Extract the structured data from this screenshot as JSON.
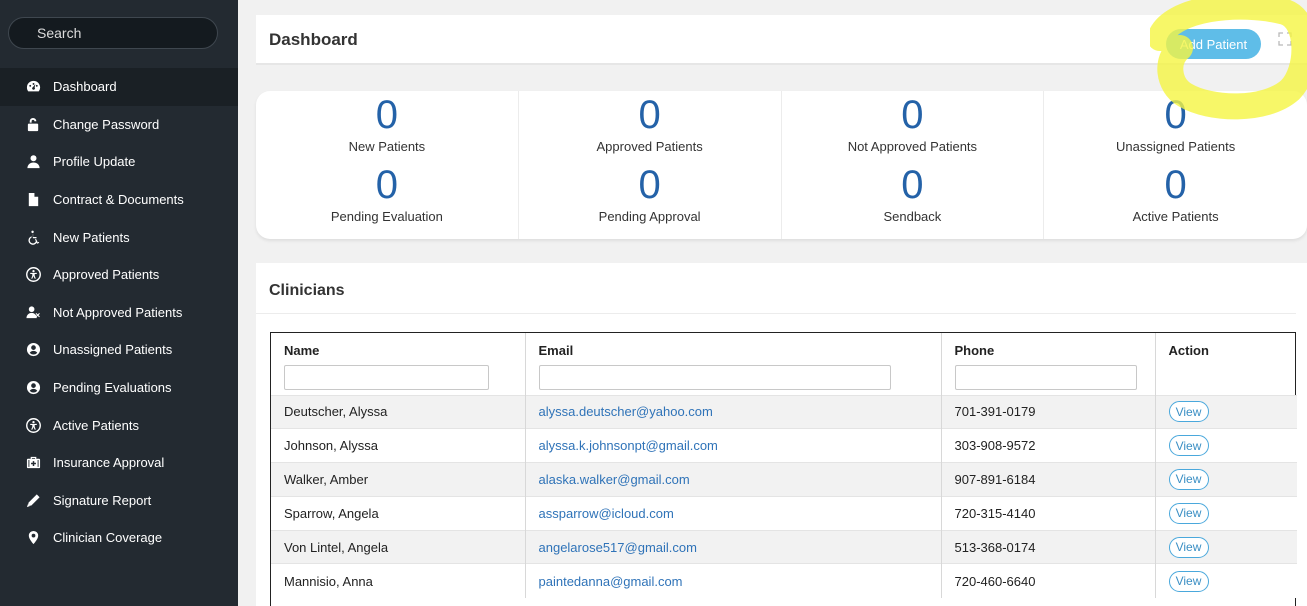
{
  "sidebar": {
    "search_placeholder": "Search",
    "items": [
      {
        "label": "Dashboard",
        "icon": "tachometer-icon"
      },
      {
        "label": "Change Password",
        "icon": "unlock-icon"
      },
      {
        "label": "Profile Update",
        "icon": "user-icon"
      },
      {
        "label": "Contract & Documents",
        "icon": "file-icon"
      },
      {
        "label": "New Patients",
        "icon": "wheelchair-icon"
      },
      {
        "label": "Approved Patients",
        "icon": "accessibility-icon"
      },
      {
        "label": "Not Approved Patients",
        "icon": "user-times-icon"
      },
      {
        "label": "Unassigned Patients",
        "icon": "user-circle-icon"
      },
      {
        "label": "Pending Evaluations",
        "icon": "user-circle-icon"
      },
      {
        "label": "Active Patients",
        "icon": "accessibility-icon"
      },
      {
        "label": "Insurance Approval",
        "icon": "medkit-icon"
      },
      {
        "label": "Signature Report",
        "icon": "pencil-icon"
      },
      {
        "label": "Clinician Coverage",
        "icon": "map-marker-icon"
      }
    ]
  },
  "header": {
    "title": "Dashboard",
    "add_patient_label": "Add Patient"
  },
  "stats": [
    {
      "value": "0",
      "label": "New Patients"
    },
    {
      "value": "0",
      "label": "Approved Patients"
    },
    {
      "value": "0",
      "label": "Not Approved Patients"
    },
    {
      "value": "0",
      "label": "Unassigned Patients"
    },
    {
      "value": "0",
      "label": "Pending Evaluation"
    },
    {
      "value": "0",
      "label": "Pending Approval"
    },
    {
      "value": "0",
      "label": "Sendback"
    },
    {
      "value": "0",
      "label": "Active Patients"
    }
  ],
  "clinicians": {
    "title": "Clinicians",
    "columns": [
      "Name",
      "Email",
      "Phone",
      "Action"
    ],
    "view_label": "View",
    "rows": [
      {
        "name": "Deutscher, Alyssa",
        "email": "alyssa.deutscher@yahoo.com",
        "phone": "701-391-0179"
      },
      {
        "name": "Johnson, Alyssa",
        "email": "alyssa.k.johnsonpt@gmail.com",
        "phone": "303-908-9572"
      },
      {
        "name": "Walker, Amber",
        "email": "alaska.walker@gmail.com",
        "phone": "907-891-6184"
      },
      {
        "name": "Sparrow, Angela",
        "email": "assparrow@icloud.com",
        "phone": "720-315-4140"
      },
      {
        "name": "Von Lintel, Angela",
        "email": "angelarose517@gmail.com",
        "phone": "513-368-0174"
      },
      {
        "name": "Mannisio, Anna",
        "email": "paintedanna@gmail.com",
        "phone": "720-460-6640"
      }
    ]
  },
  "colors": {
    "sidebar_bg": "#232a31",
    "accent_blue": "#2462a8",
    "button_blue": "#5fbde8",
    "link_blue": "#2f73b8",
    "highlighter": "#f5f542"
  }
}
